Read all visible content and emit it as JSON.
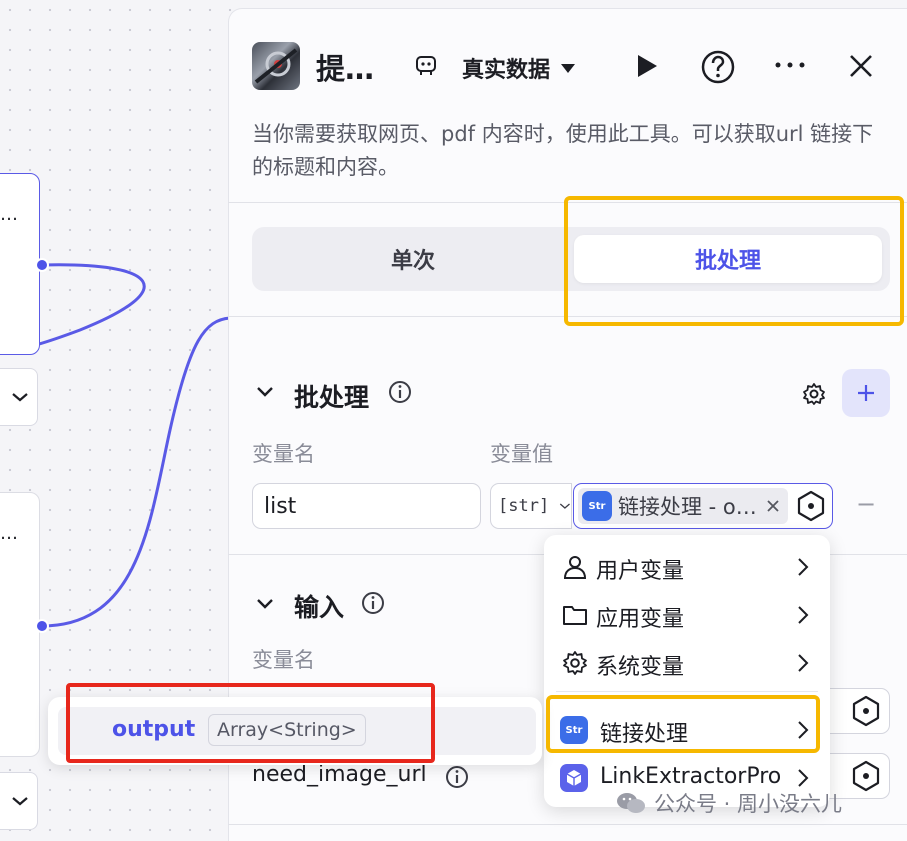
{
  "canvas": {
    "node_top_dots": "…",
    "node_bottom_dots": "…"
  },
  "panel": {
    "title": "提…",
    "data_source_label": "真实数据",
    "description": "当你需要获取网页、pdf 内容时，使用此工具。可以获取url 链接下的标题和内容。",
    "tabs": [
      {
        "label": "单次",
        "active": false
      },
      {
        "label": "批处理",
        "active": true
      }
    ],
    "batch_section": {
      "title": "批处理",
      "col_name": "变量名",
      "col_value": "变量值",
      "var_name_value": "list",
      "type_tag": "[str]",
      "ref_value": "链接处理 - o…",
      "minus": "−"
    },
    "input_section": {
      "title": "输入",
      "col_name": "变量名",
      "param_label": "need_image_url"
    }
  },
  "menu": {
    "items": [
      {
        "label": "用户变量",
        "icon": "user-icon"
      },
      {
        "label": "应用变量",
        "icon": "folder-icon"
      },
      {
        "label": "系统变量",
        "icon": "gear-icon"
      },
      {
        "label": "链接处理",
        "icon": "str-plugin-icon"
      },
      {
        "label": "LinkExtractorPro",
        "icon": "cube-icon"
      }
    ]
  },
  "output_popover": {
    "name": "output",
    "type": "Array<String>"
  },
  "watermark": {
    "text": "公众号 · 周小没六儿"
  },
  "colors": {
    "accent": "#4d53e8",
    "highlight_yellow": "#f6b800",
    "highlight_red": "#e7271c",
    "plugin_blue": "#3b6de8"
  }
}
